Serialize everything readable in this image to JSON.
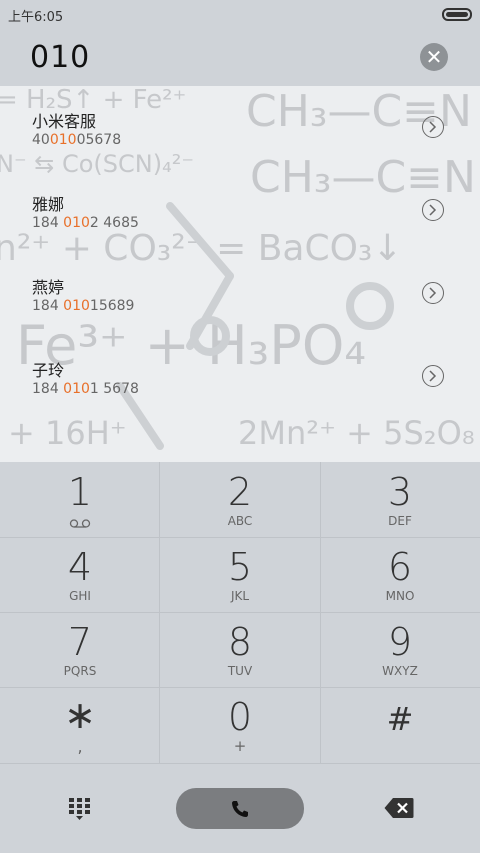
{
  "status": {
    "time": "上午6:05"
  },
  "dial": {
    "number": "010"
  },
  "contacts": [
    {
      "name": "小米客服",
      "pre": "40",
      "hl": "010",
      "post": "05678"
    },
    {
      "name": "雅娜",
      "pre": "184 ",
      "hl": "010",
      "post": "2 4685"
    },
    {
      "name": "燕婷",
      "pre": "184 ",
      "hl": "010",
      "post": "15689"
    },
    {
      "name": "子玲",
      "pre": "184 ",
      "hl": "010",
      "post": "1 5678"
    }
  ],
  "keys": [
    {
      "digit": "1",
      "letters": ""
    },
    {
      "digit": "2",
      "letters": "ABC"
    },
    {
      "digit": "3",
      "letters": "DEF"
    },
    {
      "digit": "4",
      "letters": "GHI"
    },
    {
      "digit": "5",
      "letters": "JKL"
    },
    {
      "digit": "6",
      "letters": "MNO"
    },
    {
      "digit": "7",
      "letters": "PQRS"
    },
    {
      "digit": "8",
      "letters": "TUV"
    },
    {
      "digit": "9",
      "letters": "WXYZ"
    },
    {
      "digit": "∗",
      "letters": ","
    },
    {
      "digit": "0",
      "letters": "+"
    },
    {
      "digit": "#",
      "letters": ""
    }
  ],
  "background_text": {
    "line1": "= H₂S↑ + Fe²⁺",
    "line2": "CH₃—C≡N",
    "line3": "N⁻ ⇆ Co(SCN)₄²⁻",
    "line4": "CH₃—C≡N",
    "line5": "n²⁺ + CO₃²⁻ = BaCO₃↓",
    "line6": "Fe³⁺ + H₃PO₄",
    "line7": "+ 16H⁺",
    "line8": "2Mn²⁺ + 5S₂O₈"
  },
  "icons": {
    "clear": "clear-x-icon",
    "detail": "chevron-right-circle-icon",
    "voicemail": "voicemail-icon",
    "dialpad": "dialpad-icon",
    "call": "phone-icon",
    "backspace": "backspace-icon"
  },
  "colors": {
    "highlight": "#e8702a",
    "call_button": "#7b7d80",
    "background": "#cfd3d8"
  }
}
